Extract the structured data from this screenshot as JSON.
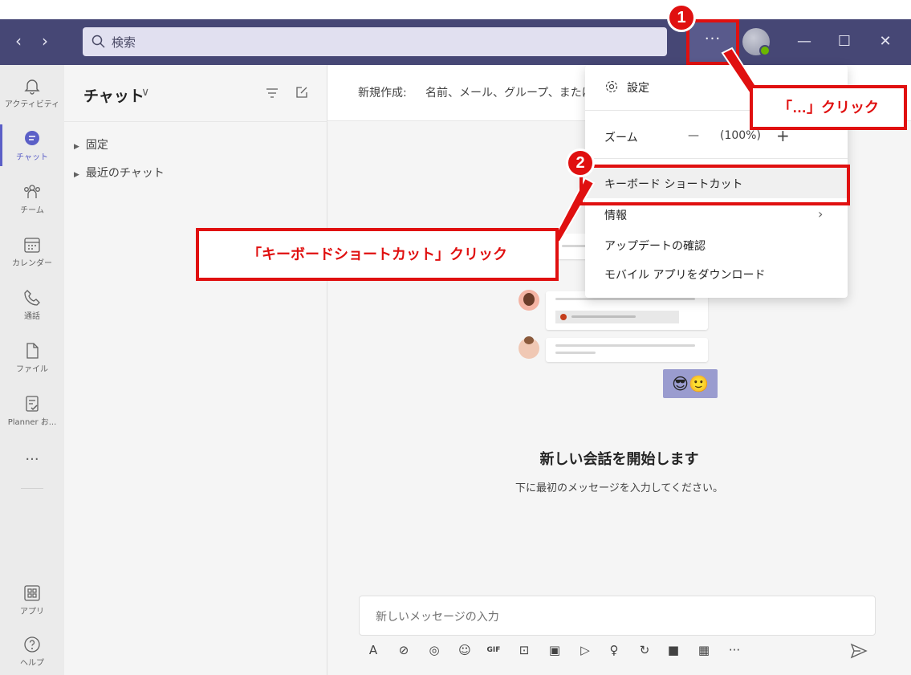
{
  "titlebar": {
    "back_label": "‹",
    "forward_label": "›",
    "search_placeholder": "検索",
    "more_label": "···",
    "minimize_label": "—",
    "maximize_label": "☐",
    "close_label": "✕"
  },
  "rail": {
    "items": [
      {
        "label": "アクティビティ",
        "icon": "bell-icon"
      },
      {
        "label": "チャット",
        "icon": "chat-icon",
        "active": true
      },
      {
        "label": "チーム",
        "icon": "teams-icon"
      },
      {
        "label": "カレンダー",
        "icon": "calendar-icon"
      },
      {
        "label": "通話",
        "icon": "phone-icon"
      },
      {
        "label": "ファイル",
        "icon": "file-icon"
      },
      {
        "label": "Planner お...",
        "icon": "planner-icon"
      }
    ],
    "more_label": "···",
    "apps_label": "アプリ",
    "help_label": "ヘルプ"
  },
  "chatlist": {
    "title": "チャット",
    "chevron": "∨",
    "groups": [
      {
        "label": "固定"
      },
      {
        "label": "最近のチャット"
      }
    ]
  },
  "main": {
    "to_label": "新規作成:",
    "to_value": "名前、メール、グループ、またはタグ",
    "empty_title": "新しい会話を開始します",
    "empty_subtitle": "下に最初のメッセージを入力してください。",
    "composer_placeholder": "新しいメッセージの入力",
    "tools": [
      "A",
      "⊘",
      "◎",
      "☺",
      "GIF",
      "⊡",
      "▣",
      "▷",
      "♀",
      "↻",
      "■",
      "▦",
      "···"
    ]
  },
  "menu": {
    "settings": "設定",
    "zoom_label": "ズーム",
    "zoom_minus": "—",
    "zoom_value": "(100%)",
    "zoom_plus": "+",
    "keyboard_shortcuts": "キーボード ショートカット",
    "info": "情報",
    "info_chevron": "›",
    "check_updates": "アップデートの確認",
    "download_mobile": "モバイル アプリをダウンロード"
  },
  "annotations": {
    "step1_number": "1",
    "step2_number": "2",
    "step1_text": "「…」クリック",
    "step2_text": "「キーボードショートカット」クリック"
  },
  "colors": {
    "titlebar": "#464775",
    "accent": "#5b5fc7",
    "annotation_red": "#e01010"
  }
}
